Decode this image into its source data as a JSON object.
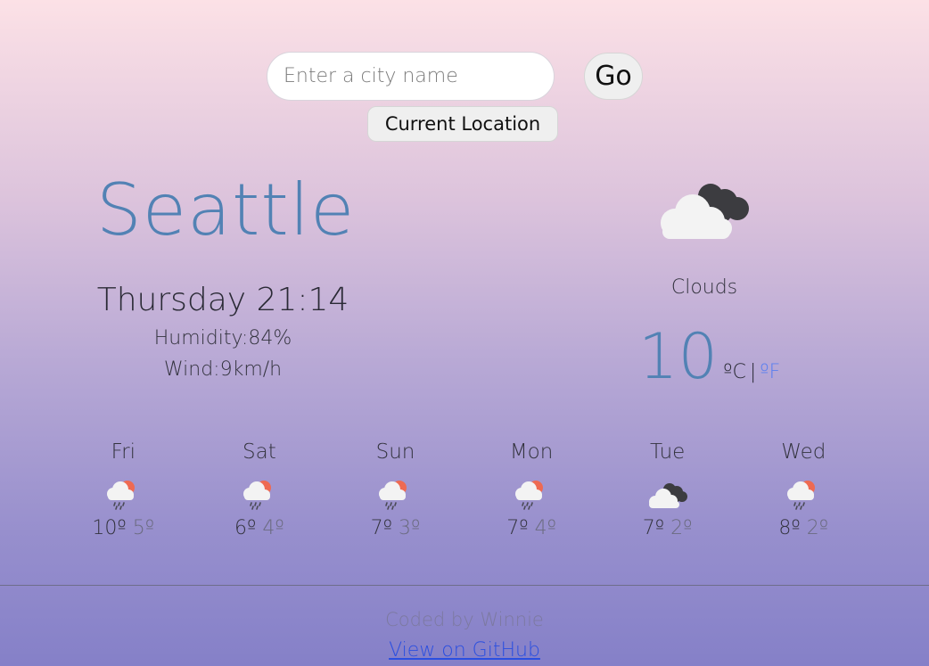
{
  "search": {
    "placeholder": "Enter a city name",
    "go_label": "Go",
    "current_location_label": "Current Location"
  },
  "current": {
    "city": "Seattle",
    "day_time": "Thursday 21:14",
    "humidity": "Humidity:84%",
    "wind": "Wind:9km/h",
    "icon": "clouds-icon",
    "description": "Clouds",
    "temperature": "10",
    "unit_c": "ºC",
    "unit_separator": "|",
    "unit_f": "ºF"
  },
  "forecast": [
    {
      "day": "Fri",
      "icon": "rain-sun-icon",
      "max": "10º",
      "min": "5º"
    },
    {
      "day": "Sat",
      "icon": "rain-sun-icon",
      "max": "6º",
      "min": "4º"
    },
    {
      "day": "Sun",
      "icon": "rain-sun-icon",
      "max": "7º",
      "min": "3º"
    },
    {
      "day": "Mon",
      "icon": "rain-sun-icon",
      "max": "7º",
      "min": "4º"
    },
    {
      "day": "Tue",
      "icon": "clouds-icon",
      "max": "7º",
      "min": "2º"
    },
    {
      "day": "Wed",
      "icon": "rain-sun-icon",
      "max": "8º",
      "min": "2º"
    }
  ],
  "footer": {
    "credit": "Coded by Winnie",
    "github_link": "View on GitHub"
  },
  "colors": {
    "accent": "#5282b4",
    "link": "#2b4fe0",
    "fahrenheit_link": "#5a7ff0"
  }
}
